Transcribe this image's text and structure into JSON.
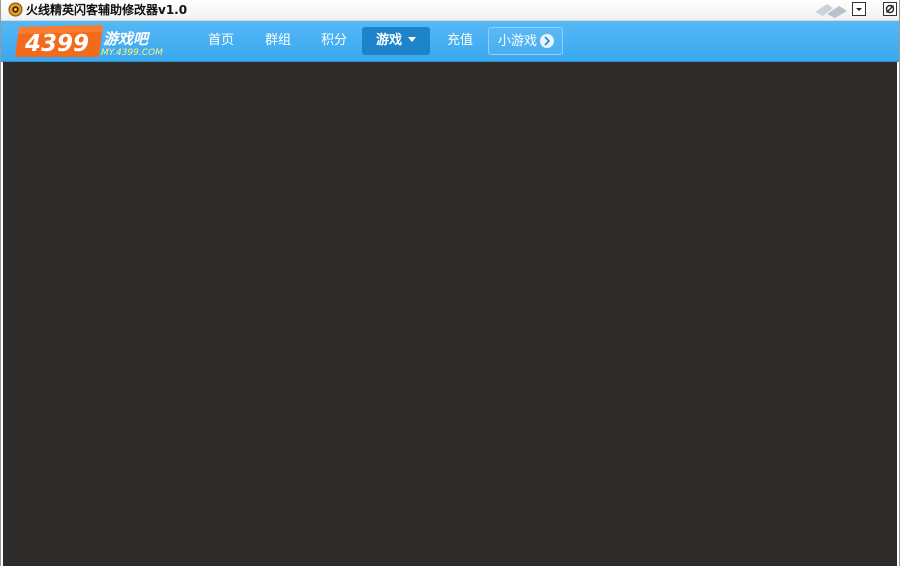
{
  "window": {
    "title": "火线精英闪客辅助修改器v1.0"
  },
  "navbar": {
    "logo": {
      "number": "4399",
      "name": "游戏吧",
      "domain": "MY.4399.COM"
    },
    "items": [
      {
        "label": "首页"
      },
      {
        "label": "群组"
      },
      {
        "label": "积分"
      },
      {
        "label": "游戏",
        "active": true
      },
      {
        "label": "充值"
      },
      {
        "label": "小游戏"
      }
    ]
  },
  "colors": {
    "navbar": "#3aa8f0",
    "active_tab": "#1d84cc",
    "content_bg": "#2e2b2b",
    "logo_orange": "#f26a1b"
  },
  "icons": {
    "app": "app-logo-icon",
    "minimize": "minimize-icon",
    "close": "close-icon",
    "games_dropdown": "caret-down-icon",
    "minigames_arrow": "chevron-right-icon"
  }
}
